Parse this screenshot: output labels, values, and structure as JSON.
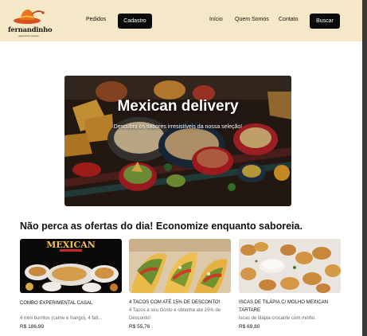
{
  "brand": {
    "name": "fernandinho",
    "tagline": "gastronomia mexicana"
  },
  "nav": {
    "pedidos": "Pedidos",
    "cadastro": "Cadastro",
    "inicio": "Início",
    "quem_somos": "Quem Somos",
    "contato": "Contato",
    "buscar": "Buscar"
  },
  "hero": {
    "title": "Mexican delivery",
    "subtitle": "Descubra os sabores irresistíveis da nossa seleção!"
  },
  "offers": {
    "title": "Não perca as ofertas do dia! Economize enquanto saboreia.",
    "items": [
      {
        "image_label": "MEXICAN",
        "title": "COMBO EXPERIMENTAL CASAL",
        "description": "4 mini burritos (carne e frango), 4 fati...",
        "price": "R$ 186,99"
      },
      {
        "title": "4 TACOS COM ATÉ 15% DE DESCONTO!",
        "description": "4 Tacos à seu Gosto e obtenha até 15% de Desconto!",
        "price": "R$ 55,76"
      },
      {
        "title": "ISCAS DE TILÁPIA C/ MOLHO MEXICAN TARTARE",
        "description": "Iscas de tilápia crocante com molho.",
        "price": "R$ 69,80"
      }
    ]
  },
  "colors": {
    "header_bg": "#f5e8c8",
    "button_bg": "#0b0b0b",
    "button_text": "#ffffff"
  }
}
